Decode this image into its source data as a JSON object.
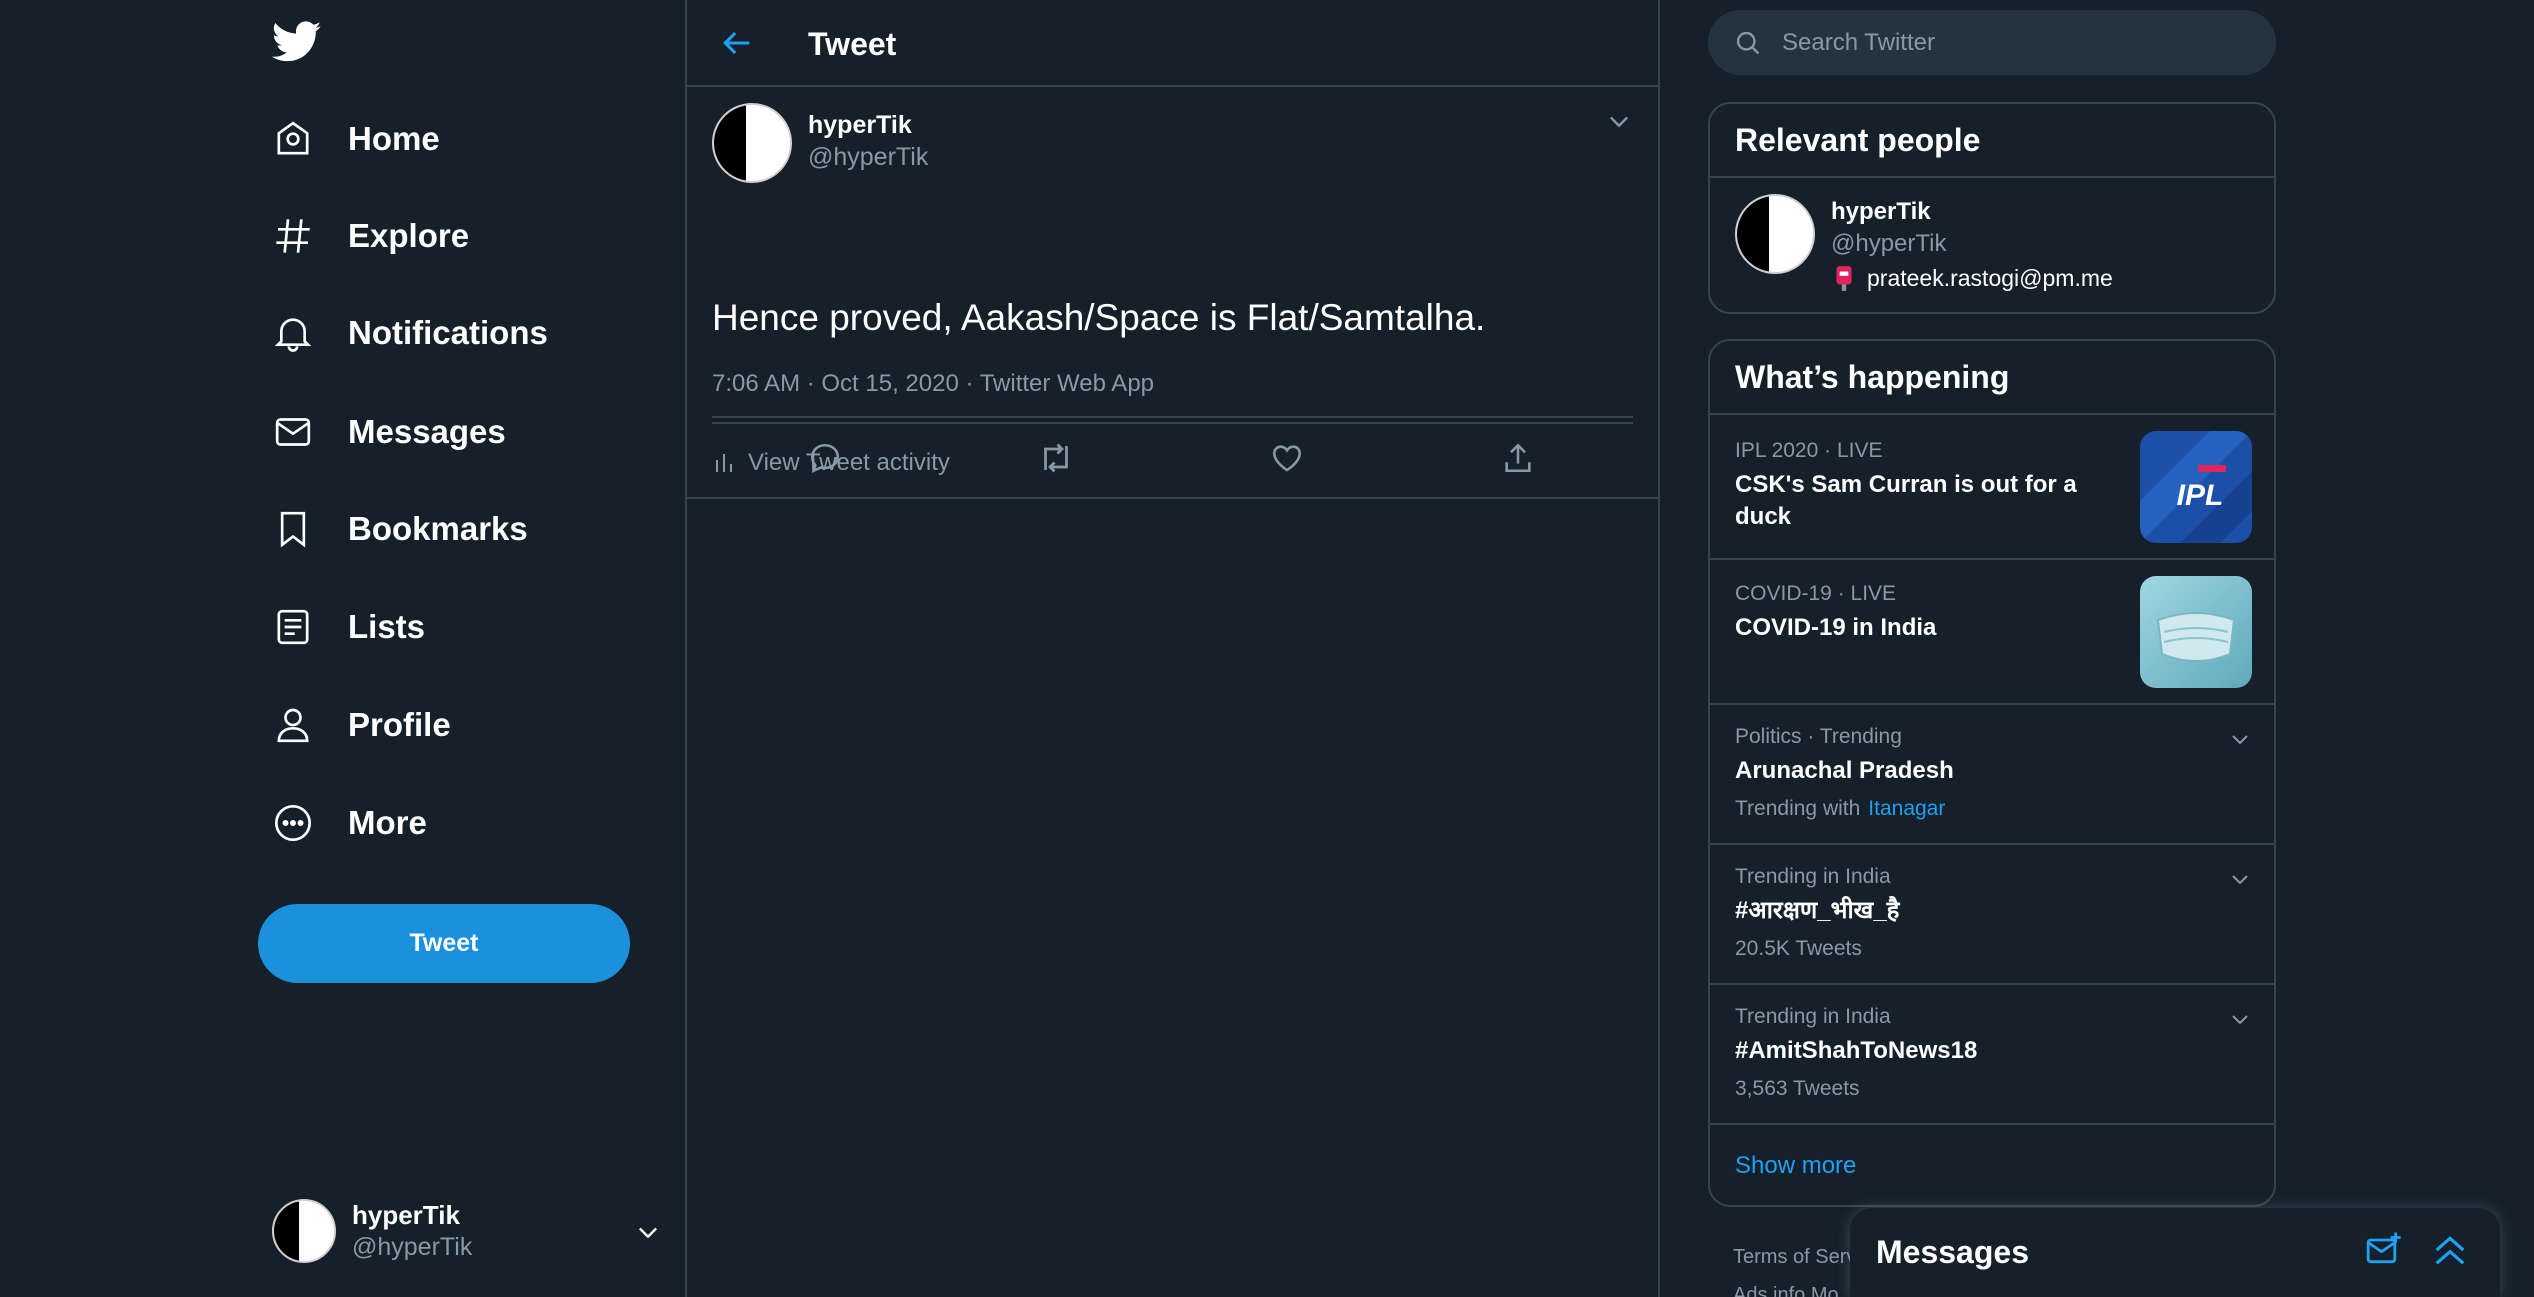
{
  "sidebar": {
    "nav": [
      {
        "label": "Home",
        "icon": "home-icon"
      },
      {
        "label": "Explore",
        "icon": "hashtag-icon"
      },
      {
        "label": "Notifications",
        "icon": "bell-icon"
      },
      {
        "label": "Messages",
        "icon": "envelope-icon"
      },
      {
        "label": "Bookmarks",
        "icon": "bookmark-icon"
      },
      {
        "label": "Lists",
        "icon": "list-icon"
      },
      {
        "label": "Profile",
        "icon": "person-icon"
      },
      {
        "label": "More",
        "icon": "more-circle-icon"
      }
    ],
    "tweet_button": "Tweet",
    "account": {
      "name": "hyperTik",
      "handle": "@hyperTik"
    }
  },
  "main": {
    "title": "Tweet",
    "tweet": {
      "author_name": "hyperTik",
      "author_handle": "@hyperTik",
      "text": "Hence proved, Aakash/Space is Flat/Samtalha.",
      "timestamp": "7:06 AM · Oct 15, 2020 · Twitter Web App",
      "activity_label": "View Tweet activity"
    }
  },
  "right": {
    "search_placeholder": "Search Twitter",
    "relevant_people": {
      "title": "Relevant people",
      "person": {
        "name": "hyperTik",
        "handle": "@hyperTik",
        "bio": "prateek.rastogi@pm.me"
      }
    },
    "whats_happening": {
      "title": "What’s happening",
      "trends": [
        {
          "context": "IPL 2020 · LIVE",
          "title": "CSK's Sam Curran is out for a duck"
        },
        {
          "context": "COVID-19 · LIVE",
          "title": "COVID-19 in India"
        },
        {
          "context": "Politics · Trending",
          "title": "Arunachal Pradesh",
          "sub": "Trending with",
          "link": "Itanagar"
        },
        {
          "context": "Trending in India",
          "title": "#आरक्षण_भीख_है",
          "sub": "20.5K Tweets"
        },
        {
          "context": "Trending in India",
          "title": "#AmitShahToNews18",
          "sub": "3,563 Tweets"
        }
      ],
      "show_more": "Show more"
    },
    "footer": {
      "line1": "Terms of Serv",
      "line2": "Ads info  Mo"
    },
    "messages_drawer": {
      "title": "Messages"
    }
  },
  "colors": {
    "background": "#15202b",
    "accent": "#1da1f2",
    "button": "#1a91da",
    "border": "#38444d",
    "muted": "#8899a6"
  }
}
